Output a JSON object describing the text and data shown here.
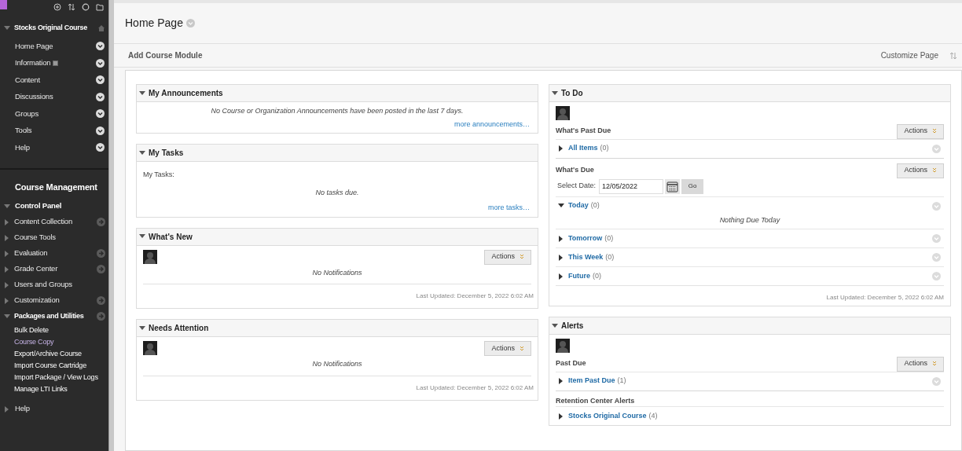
{
  "course_menu": {
    "title": "Stocks Original Course",
    "expanded": true,
    "items": [
      {
        "label": "Home Page",
        "badge": false
      },
      {
        "label": "Information",
        "badge": true
      },
      {
        "label": "Content",
        "badge": false
      },
      {
        "label": "Discussions",
        "badge": false
      },
      {
        "label": "Groups",
        "badge": false
      },
      {
        "label": "Tools",
        "badge": false
      },
      {
        "label": "Help",
        "badge": false
      }
    ]
  },
  "management": {
    "heading": "Course Management",
    "control_panel": {
      "label": "Control Panel",
      "expanded": true,
      "items": [
        {
          "label": "Content Collection",
          "expanded": false,
          "has_menu": true
        },
        {
          "label": "Course Tools",
          "expanded": false,
          "has_menu": false
        },
        {
          "label": "Evaluation",
          "expanded": false,
          "has_menu": true
        },
        {
          "label": "Grade Center",
          "expanded": false,
          "has_menu": true
        },
        {
          "label": "Users and Groups",
          "expanded": false,
          "has_menu": false
        },
        {
          "label": "Customization",
          "expanded": false,
          "has_menu": true
        },
        {
          "label": "Packages and Utilities",
          "expanded": true,
          "has_menu": true,
          "children": [
            {
              "label": "Bulk Delete",
              "visited": false
            },
            {
              "label": "Course Copy",
              "visited": true
            },
            {
              "label": "Export/Archive Course",
              "visited": false
            },
            {
              "label": "Import Course Cartridge",
              "visited": false
            },
            {
              "label": "Import Package / View Logs",
              "visited": false
            },
            {
              "label": "Manage LTI Links",
              "visited": false
            }
          ]
        }
      ]
    },
    "help": {
      "label": "Help",
      "expanded": false
    }
  },
  "page": {
    "title": "Home Page",
    "add_module": "Add Course Module",
    "customize": "Customize Page"
  },
  "left_modules": [
    {
      "kind": "announcements",
      "title": "My Announcements",
      "expanded": true,
      "message": "No Course or Organization Announcements have been posted in the last 7 days.",
      "link": "more announcements…"
    },
    {
      "kind": "tasks",
      "title": "My Tasks",
      "expanded": true,
      "label": "My Tasks:",
      "message": "No tasks due.",
      "link": "more tasks…"
    },
    {
      "kind": "notifications",
      "title": "What's New",
      "expanded": true,
      "action": "Actions",
      "message": "No Notifications",
      "updated": "Last Updated: December 5, 2022 6:02 AM"
    },
    {
      "kind": "notifications",
      "title": "Needs Attention",
      "expanded": true,
      "action": "Actions",
      "message": "No Notifications",
      "updated": "Last Updated: December 5, 2022 6:02 AM"
    }
  ],
  "right_modules": [
    {
      "kind": "todo",
      "title": "To Do",
      "expanded": true,
      "updated": "Last Updated: December 5, 2022 6:02 AM",
      "sections": [
        {
          "heading": "What's Past Due",
          "action": "Actions",
          "groups": [
            {
              "label": "All Items",
              "count": "(0)",
              "expanded": false
            }
          ]
        },
        {
          "heading": "What's Due",
          "action": "Actions",
          "date": {
            "label": "Select Date:",
            "value": "12/05/2022",
            "go": "Go"
          },
          "groups": [
            {
              "label": "Today",
              "count": "(0)",
              "expanded": true,
              "empty": "Nothing Due Today"
            },
            {
              "label": "Tomorrow",
              "count": "(0)",
              "expanded": false
            },
            {
              "label": "This Week",
              "count": "(0)",
              "expanded": false
            },
            {
              "label": "Future",
              "count": "(0)",
              "expanded": false
            }
          ]
        }
      ]
    },
    {
      "kind": "todo",
      "title": "Alerts",
      "expanded": true,
      "sections": [
        {
          "heading": "Past Due",
          "action": "Actions",
          "groups": [
            {
              "label": "Item Past Due",
              "count": "(1)",
              "expanded": false
            }
          ]
        },
        {
          "heading": "Retention Center Alerts",
          "groups": [
            {
              "label": "Stocks Original Course",
              "count": "(4)",
              "expanded": false
            }
          ]
        }
      ]
    }
  ]
}
